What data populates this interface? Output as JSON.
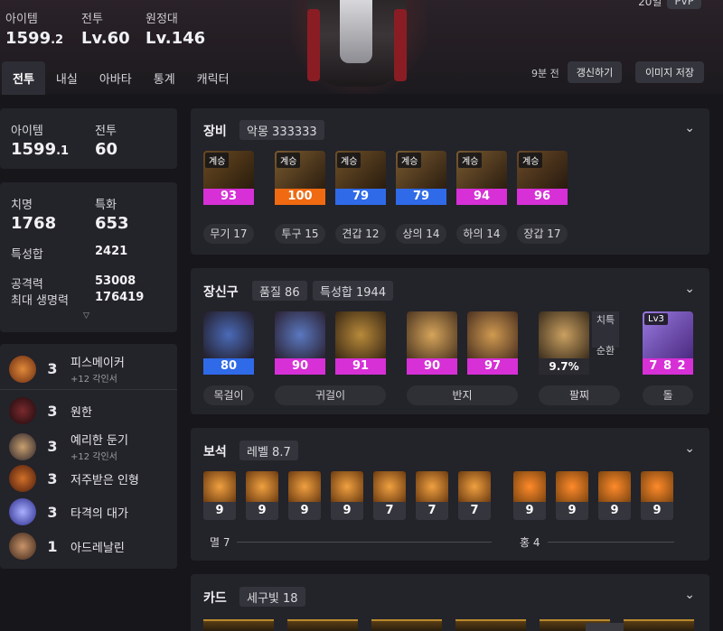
{
  "header": {
    "stats": [
      {
        "label": "아이템",
        "value": "1599",
        "decimal": ".2"
      },
      {
        "label": "전투",
        "value": "Lv.60",
        "decimal": ""
      },
      {
        "label": "원정대",
        "value": "Lv.146",
        "decimal": ""
      }
    ],
    "top_right": {
      "level": "20일",
      "pill": "PvP"
    },
    "tabs": [
      "전투",
      "내실",
      "아바타",
      "통계",
      "캐릭터"
    ],
    "active_tab": "전투",
    "updated": "9분 전",
    "refresh_label": "갱신하기",
    "save_image_label": "이미지 저장"
  },
  "left": {
    "item_level": {
      "label": "아이템",
      "value": "1599",
      "decimal": ".1"
    },
    "combat": {
      "label": "전투",
      "value": "60"
    },
    "crit": {
      "label": "치명",
      "value": "1768"
    },
    "spec": {
      "label": "특화",
      "value": "653"
    },
    "total_stats": {
      "label": "특성합",
      "value": "2421"
    },
    "attack": {
      "label": "공격력",
      "value": "53008"
    },
    "max_hp": {
      "label": "최대 생명력",
      "value": "176419"
    },
    "engravings": [
      {
        "level": "3",
        "name": "피스메이커",
        "sub": "+12 각인서",
        "color": "#b5541c"
      },
      {
        "level": "3",
        "name": "원한",
        "sub": "",
        "color": "#6a1f22"
      },
      {
        "level": "3",
        "name": "예리한 둔기",
        "sub": "+12 각인서",
        "color": "#3c3c48"
      },
      {
        "level": "3",
        "name": "저주받은 인형",
        "sub": "",
        "color": "#8a3a1a"
      },
      {
        "level": "3",
        "name": "타격의 대가",
        "sub": "",
        "color": "#4b4ad0"
      },
      {
        "level": "1",
        "name": "아드레날린",
        "sub": "",
        "color": "#5a3a2a"
      }
    ]
  },
  "equipment": {
    "title": "장비",
    "badge": "악몽 333333",
    "items": [
      {
        "tag": "계승",
        "quality": "93",
        "color": "#d630d6",
        "label": "무기 17"
      },
      {
        "tag": "계승",
        "quality": "100",
        "color": "#f06a12",
        "label": "투구 15"
      },
      {
        "tag": "계승",
        "quality": "79",
        "color": "#2f6ae8",
        "label": "견갑 12"
      },
      {
        "tag": "계승",
        "quality": "79",
        "color": "#2f6ae8",
        "label": "상의 14"
      },
      {
        "tag": "계승",
        "quality": "94",
        "color": "#d630d6",
        "label": "하의 14"
      },
      {
        "tag": "계승",
        "quality": "96",
        "color": "#d630d6",
        "label": "장갑 17"
      }
    ]
  },
  "accessories": {
    "title": "장신구",
    "badges": [
      "품질 86",
      "특성합 1944"
    ],
    "items": [
      {
        "quality": "80",
        "color": "#2f6ae8"
      },
      {
        "quality": "90",
        "color": "#d630d6"
      },
      {
        "quality": "91",
        "color": "#d630d6"
      },
      {
        "quality": "90",
        "color": "#d630d6"
      },
      {
        "quality": "97",
        "color": "#d630d6"
      },
      {
        "quality": "9.7%",
        "color": "#2a2a30"
      },
      {
        "quality": "7 8 2",
        "color": "#d630d6"
      }
    ],
    "bracelet_tags": [
      "치특",
      "순환"
    ],
    "stone_level": "Lv3",
    "labels": [
      "목걸이",
      "귀걸이",
      "반지",
      "팔찌",
      "돌"
    ]
  },
  "gems": {
    "title": "보석",
    "badge": "레벨 8.7",
    "values": [
      "9",
      "9",
      "9",
      "9",
      "7",
      "7",
      "7",
      "9",
      "9",
      "9",
      "9"
    ],
    "group_labels": [
      "멸 7",
      "홍 4"
    ]
  },
  "cards": {
    "title": "카드",
    "badge": "세구빛 18"
  }
}
